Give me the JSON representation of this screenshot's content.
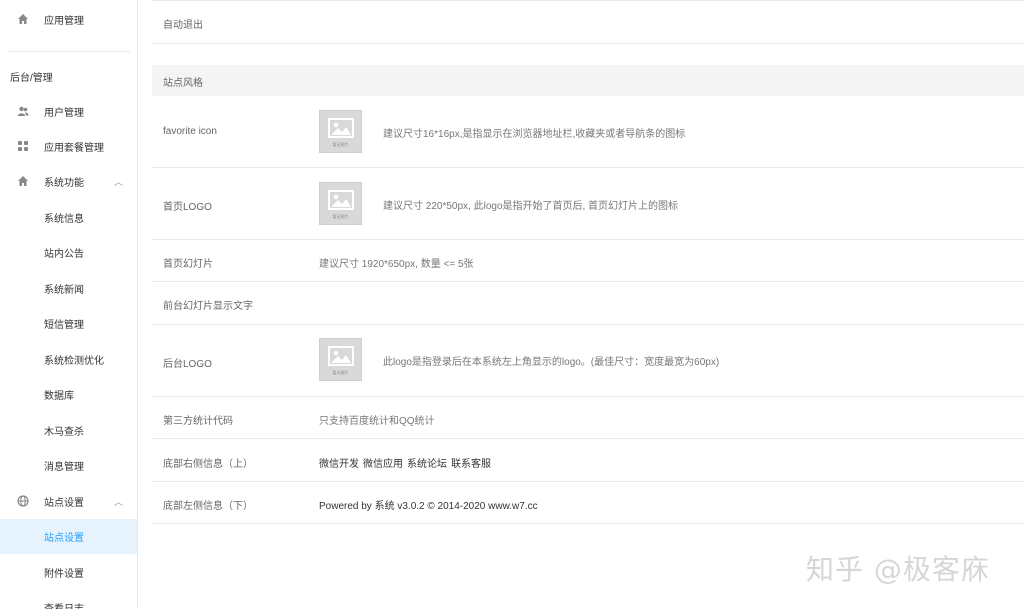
{
  "sidebar": {
    "top_item": "应用管理",
    "group_title": "后台/管理",
    "items": [
      {
        "label": "用户管理"
      },
      {
        "label": "应用套餐管理"
      },
      {
        "label": "系统功能"
      },
      {
        "label": "系统信息"
      },
      {
        "label": "站内公告"
      },
      {
        "label": "系统新闻"
      },
      {
        "label": "短信管理"
      },
      {
        "label": "系统检测优化"
      },
      {
        "label": "数据库"
      },
      {
        "label": "木马查杀"
      },
      {
        "label": "消息管理"
      },
      {
        "label": "站点设置"
      },
      {
        "label": "站点设置"
      },
      {
        "label": "附件设置"
      },
      {
        "label": "查看日志"
      }
    ]
  },
  "main": {
    "auto_logout": {
      "label": "自动退出"
    },
    "section_title": "站点风格",
    "favicon": {
      "label": "favorite icon",
      "hint": "建议尺寸16*16px,是指显示在浏览器地址栏,收藏夹或者导航条的图标",
      "thumb_caption": "暂无图片"
    },
    "home_logo": {
      "label": "首页LOGO",
      "hint": "建议尺寸 220*50px, 此logo是指开始了首页后, 首页幻灯片上的图标",
      "thumb_caption": "暂无图片"
    },
    "slides": {
      "label": "首页幻灯片",
      "value": "建议尺寸 1920*650px, 数量 <= 5张"
    },
    "slide_text": {
      "label": "前台幻灯片显示文字"
    },
    "admin_logo": {
      "label": "后台LOGO",
      "hint": "此logo是指登录后在本系统左上角显示的logo。(最佳尺寸：宽度最宽为60px)",
      "thumb_caption": "暂无图片"
    },
    "stats_code": {
      "label": "第三方统计代码",
      "value": "只支持百度统计和QQ统计"
    },
    "footer_right": {
      "label": "底部右侧信息（上）",
      "links": [
        "微信开发",
        "微信应用",
        "系统论坛",
        "联系客服"
      ]
    },
    "footer_left": {
      "label": "底部左侧信息（下）",
      "value": "Powered by 系统 v3.0.2 © 2014-2020 www.w7.cc"
    }
  },
  "watermark": "知乎 @极客庥",
  "colors": {
    "accent": "#1e9fff",
    "active_bg": "#e6f3fd",
    "section_bg": "#f4f4f4"
  }
}
